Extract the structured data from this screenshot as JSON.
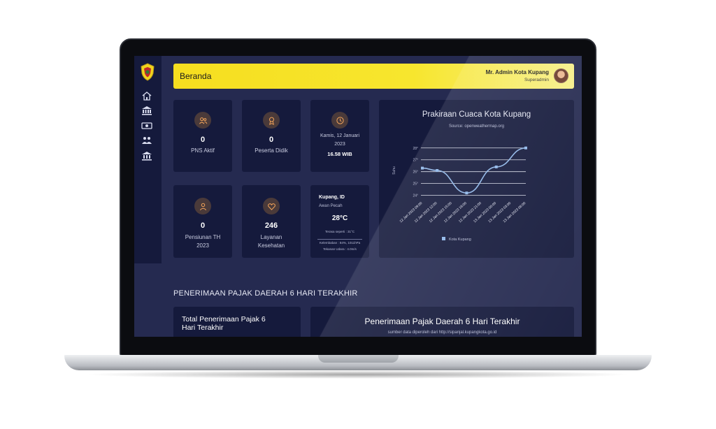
{
  "header": {
    "title": "Beranda",
    "user_name": "Mr. Admin Kota Kupang",
    "user_role": "Superadmin"
  },
  "sidebar": {
    "items": [
      {
        "icon": "home-icon"
      },
      {
        "icon": "bank-icon"
      },
      {
        "icon": "money-icon"
      },
      {
        "icon": "users-icon"
      },
      {
        "icon": "building-icon"
      }
    ]
  },
  "stats": {
    "pns_aktif": {
      "value": "0",
      "label": "PNS Aktif"
    },
    "peserta_didik": {
      "value": "0",
      "label": "Peserta Didik"
    },
    "pensiunan": {
      "value": "0",
      "label_line1": "Pensiunan TH",
      "label_line2": "2023"
    },
    "layanan": {
      "value": "246",
      "label_line1": "Layanan",
      "label_line2": "Kesehatan"
    }
  },
  "clock": {
    "date_line1": "Kamis, 12 Januari",
    "date_line2": "2023",
    "time": "16.58 WIB"
  },
  "weather": {
    "city": "Kupang, ID",
    "description": "Awan Pecah",
    "temperature": "28°C",
    "feels_like": "Terasa seperti : 31°C",
    "humidity": "Kelembaban : 84%, 1011hPa",
    "wind": "Tekanan Udara : 4.0m/s"
  },
  "chart_data": {
    "type": "line",
    "title": "Prakiraan Cuaca Kota Kupang",
    "subtitle": "Source: openweathermap.org",
    "ylabel": "Suhu",
    "y_ticks": [
      "24°",
      "25°",
      "26°",
      "27°",
      "28°"
    ],
    "ylim": [
      23.8,
      28.4
    ],
    "categories": [
      "12 Jan 2023 09:00",
      "12 Jan 2023 12:00",
      "12 Jan 2023 15:00",
      "12 Jan 2023 18:00",
      "12 Jan 2023 21:00",
      "13 Jan 2023 00:00",
      "13 Jan 2023 03:00",
      "13 Jan 2023 06:00"
    ],
    "series": [
      {
        "name": "Kota Kupang",
        "values": [
          26.3,
          26.1,
          null,
          24.2,
          null,
          26.4,
          null,
          28.0
        ]
      }
    ],
    "line_color": "#8fb6e8",
    "legend": "bottom"
  },
  "tax": {
    "section_title": "PENERIMAAN PAJAK DAERAH 6 HARI TERAKHIR",
    "total_title_line1": "Total Penerimaan Pajak 6",
    "total_title_line2": "Hari Terakhir",
    "chart_title": "Penerimaan Pajak Daerah 6 Hari Terakhir",
    "chart_source": "sumber data diperoleh dari http://sipanjal.kupangkota.go.id"
  },
  "colors": {
    "header_yellow": "#f6de1f",
    "panel": "#151a3c",
    "background": "#252a50",
    "icon_orange": "#f2a35a"
  }
}
